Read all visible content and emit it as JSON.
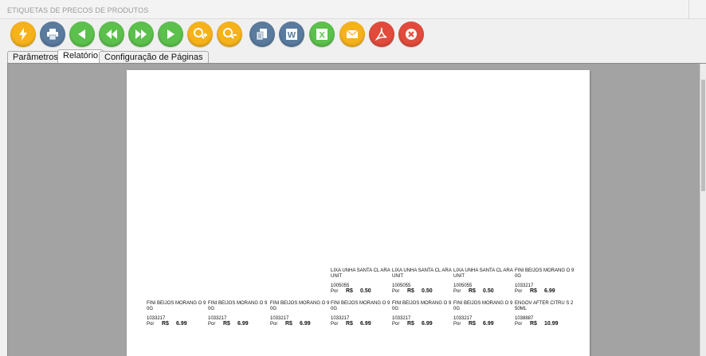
{
  "window": {
    "title": "ETIQUETAS DE PRECOS DE PRODUTOS"
  },
  "toolbar": {
    "buttons": [
      {
        "name": "execute-button",
        "icon": "lightning-icon",
        "color": "#f6b21b"
      },
      {
        "name": "print-button",
        "icon": "printer-icon",
        "color": "#5a7b9e"
      },
      {
        "name": "first-page-button",
        "icon": "triangle-left-icon",
        "color": "#5cc04c"
      },
      {
        "name": "previous-page-button",
        "icon": "double-left-icon",
        "color": "#5cc04c"
      },
      {
        "name": "next-page-button",
        "icon": "double-right-icon",
        "color": "#5cc04c"
      },
      {
        "name": "last-page-button",
        "icon": "triangle-right-icon",
        "color": "#5cc04c"
      },
      {
        "name": "zoom-in-button",
        "icon": "zoom-in-icon",
        "color": "#f6b21b"
      },
      {
        "name": "zoom-out-button",
        "icon": "zoom-out-icon",
        "color": "#f6b21b"
      },
      {
        "name": "export-button",
        "icon": "export-icon",
        "color": "#5a7b9e"
      },
      {
        "name": "word-export-button",
        "icon": "word-icon",
        "color": "#5a7b9e"
      },
      {
        "name": "excel-export-button",
        "icon": "excel-icon",
        "color": "#5cc04c"
      },
      {
        "name": "email-button",
        "icon": "mail-icon",
        "color": "#f6b21b"
      },
      {
        "name": "pdf-export-button",
        "icon": "pdf-icon",
        "color": "#e24b3b"
      },
      {
        "name": "close-button",
        "icon": "close-icon",
        "color": "#e24b3b"
      }
    ]
  },
  "tabs": [
    {
      "label": "Parâmetros"
    },
    {
      "label": "Relatório"
    },
    {
      "label": "Configuração de Páginas"
    }
  ],
  "labels_row1": [
    {
      "name": "LIXA UNHA SANTA CL ARA UNIT",
      "code": "1005055",
      "por": "Por",
      "currency": "R$",
      "price": "0.50"
    },
    {
      "name": "LIXA UNHA SANTA CL ARA UNIT",
      "code": "1005055",
      "por": "Por",
      "currency": "R$",
      "price": "0.50"
    },
    {
      "name": "LIXA UNHA SANTA CL ARA UNIT",
      "code": "1005055",
      "por": "Por",
      "currency": "R$",
      "price": "0.50"
    },
    {
      "name": "FINI BEIJOS MORANG O 90G",
      "code": "1033217",
      "por": "Por",
      "currency": "R$",
      "price": "6.99"
    }
  ],
  "labels_row2": [
    {
      "name": "FINI BEIJOS MORANG O 90G",
      "code": "1033217",
      "por": "Por",
      "currency": "R$",
      "price": "6.99"
    },
    {
      "name": "FINI BEIJOS MORANG O 90G",
      "code": "1033217",
      "por": "Por",
      "currency": "R$",
      "price": "6.99"
    },
    {
      "name": "FINI BEIJOS MORANG O 90G",
      "code": "1033217",
      "por": "Por",
      "currency": "R$",
      "price": "6.99"
    },
    {
      "name": "FINI BEIJOS MORANG O 90G",
      "code": "1033217",
      "por": "Por",
      "currency": "R$",
      "price": "6.99"
    },
    {
      "name": "FINI BEIJOS MORANG O 90G",
      "code": "1033217",
      "por": "Por",
      "currency": "R$",
      "price": "6.99"
    },
    {
      "name": "FINI BEIJOS MORANG O 90G",
      "code": "1033217",
      "por": "Por",
      "currency": "R$",
      "price": "6.99"
    },
    {
      "name": "ENGOV AFTER CITRU S 250ML",
      "code": "1038887",
      "por": "Por",
      "currency": "R$",
      "price": "10.99"
    }
  ]
}
